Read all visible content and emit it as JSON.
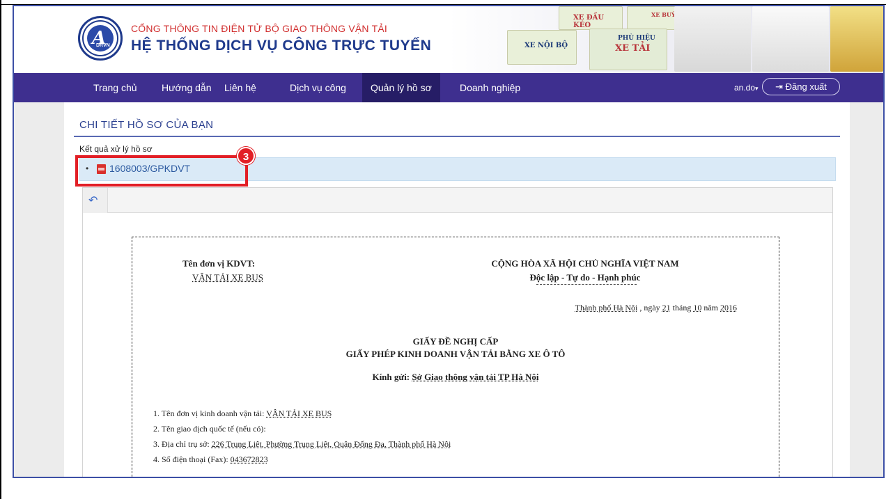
{
  "header": {
    "org_line": "CỔNG THÔNG TIN ĐIỆN TỬ BỘ GIAO THÔNG VẬN TẢI",
    "system_title": "HỆ THỐNG DỊCH VỤ CÔNG TRỰC TUYẾN",
    "logo_text": "DRVN",
    "badges": {
      "xe_noi_bo": "XE NỘI BỘ",
      "xe_dau_keo": "XE ĐẦU KÉO",
      "xe_buyt": "XE BUÝT",
      "phu_hieu": "PHÙ HIỆU",
      "xe_tai": "XE TẢI"
    }
  },
  "nav": {
    "items": [
      "Trang chủ",
      "Hướng dẫn",
      "Liên hệ",
      "Dịch vụ công",
      "Quản lý hồ sơ",
      "Doanh nghiệp"
    ],
    "active_index": 4,
    "user": "an.do",
    "logout": "Đăng xuất"
  },
  "page": {
    "title": "CHI TIẾT HỒ SƠ CỦA BẠN",
    "result_label": "Kết quả xử lý hồ sơ",
    "file_name": "1608003/GPKDVT",
    "step_number": "3"
  },
  "document": {
    "unit_label": "Tên đơn vị KDVT:",
    "unit_value": "VẬN TẢI XE BUS",
    "nation": "CỘNG HÒA XÃ HỘI CHỦ NGHĨA VIỆT NAM",
    "motto": "Độc lập - Tự do - Hạnh phúc",
    "date": {
      "place": "Thành phố Hà Nội",
      "day_prefix": ", ngày",
      "day": "21",
      "month_prefix": "tháng",
      "month": "10",
      "year_prefix": "năm",
      "year": "2016"
    },
    "title1": "GIẤY ĐỀ NGHỊ CẤP",
    "title2": "GIẤY PHÉP KINH DOANH VẬN TẢI BẰNG XE Ô TÔ",
    "to_label": "Kính gửi:",
    "to_value": "Sở Giao thông vận tải TP Hà Nội",
    "lines": [
      {
        "label": "1. Tên đơn vị kinh doanh vận tải:",
        "value": "VẬN TẢI XE BUS"
      },
      {
        "label": "2. Tên giao dịch quốc tế (nếu có):",
        "value": ""
      },
      {
        "label": "3. Địa chỉ trụ sở:",
        "value": "226 Trung Liệt, Phường Trung Liệt, Quận Đống Đa, Thành phố Hà Nội"
      },
      {
        "label": "4. Số điện thoại (Fax):",
        "value": "043672823"
      }
    ]
  },
  "colors": {
    "nav_bg": "#3e2f8f",
    "nav_active": "#261d66",
    "highlight": "#e21f26",
    "accent_blue": "#2a3f8f"
  }
}
